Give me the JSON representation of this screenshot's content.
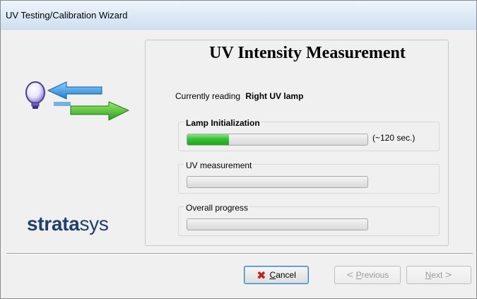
{
  "window": {
    "title": "UV Testing/Calibration Wizard"
  },
  "sidebar": {
    "brand_bold": "strata",
    "brand_light": "sys",
    "logo_icon": "lamp-arrows-icon"
  },
  "main": {
    "heading": "UV Intensity Measurement",
    "reading_label": "Currently reading",
    "reading_value": "Right UV lamp",
    "groups": [
      {
        "label": "Lamp Initialization",
        "progress": 0.23,
        "note": "(~120 sec.)"
      },
      {
        "label": "UV measurement",
        "progress": 0
      },
      {
        "label": "Overall progress",
        "progress": 0
      }
    ]
  },
  "buttons": {
    "cancel": {
      "label_u": "C",
      "label_rest": "ancel",
      "icon": "close-icon"
    },
    "previous": {
      "prefix": "<",
      "label_u": "P",
      "label_rest": "revious"
    },
    "next": {
      "label_u": "N",
      "label_rest": "ext",
      "suffix": ">"
    }
  },
  "colors": {
    "progress_green": "#35c231",
    "brand_blue": "#1f3f6e",
    "cancel_red": "#c81a1a"
  }
}
